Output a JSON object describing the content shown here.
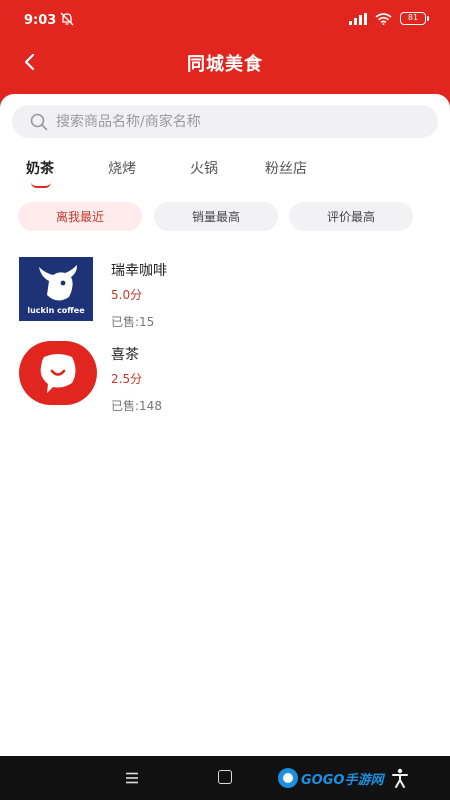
{
  "status_bar": {
    "time": "9:03",
    "battery": "81"
  },
  "header": {
    "title": "同城美食"
  },
  "search": {
    "placeholder": "搜索商品名称/商家名称"
  },
  "tabs": [
    {
      "label": "奶茶",
      "active": true
    },
    {
      "label": "烧烤",
      "active": false
    },
    {
      "label": "火锅",
      "active": false
    },
    {
      "label": "粉丝店",
      "active": false
    }
  ],
  "sort_options": [
    {
      "label": "离我最近",
      "active": true
    },
    {
      "label": "销量最高",
      "active": false
    },
    {
      "label": "评价最高",
      "active": false
    }
  ],
  "shops": [
    {
      "name": "瑞幸咖啡",
      "rating": "5.0分",
      "sold": "已售:15",
      "logo_text": "luckin coffee"
    },
    {
      "name": "喜茶",
      "rating": "2.5分",
      "sold": "已售:148"
    }
  ],
  "nav_bar": {
    "watermark": "GOGO手游网"
  },
  "colors": {
    "brand_red": "#e0261e",
    "rating_red": "#c0392b",
    "luckin_blue": "#1e3278"
  }
}
